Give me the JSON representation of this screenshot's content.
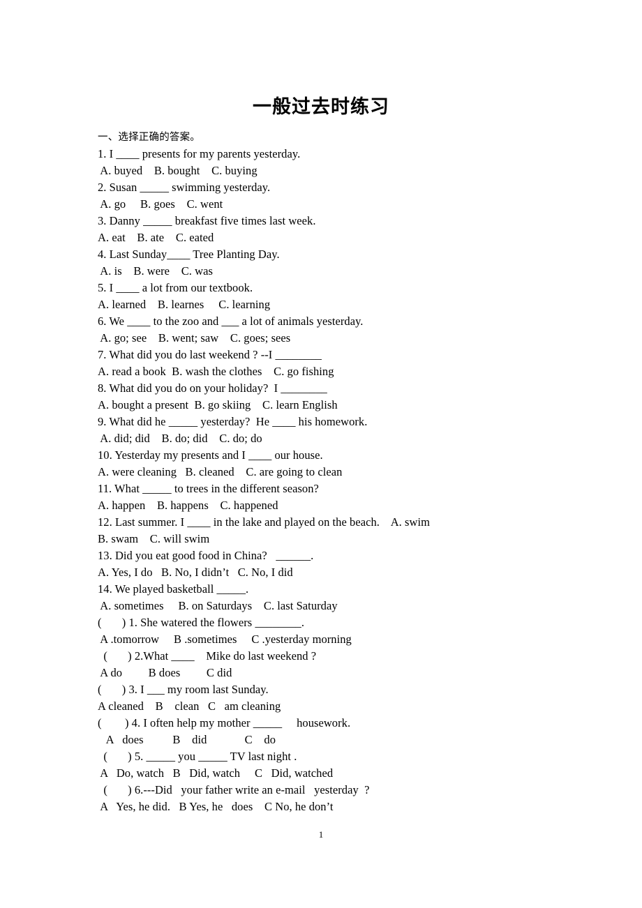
{
  "document": {
    "title": "一般过去时练习",
    "page_number": "1",
    "section_heading": "一、选择正确的答案。"
  },
  "lines": [
    {
      "text": "1. I ____ presents for my parents yesterday.",
      "kind": "question"
    },
    {
      "text": " A. buyed    B. bought    C. buying",
      "kind": "options"
    },
    {
      "text": "2. Susan _____ swimming yesterday.",
      "kind": "question"
    },
    {
      "text": " A. go     B. goes    C. went",
      "kind": "options"
    },
    {
      "text": "3. Danny _____ breakfast five times last week.",
      "kind": "question"
    },
    {
      "text": "A. eat    B. ate    C. eated",
      "kind": "options"
    },
    {
      "text": "4. Last Sunday____ Tree Planting Day.",
      "kind": "question"
    },
    {
      "text": " A. is    B. were    C. was",
      "kind": "options"
    },
    {
      "text": "5. I ____ a lot from our textbook.",
      "kind": "question"
    },
    {
      "text": "A. learned    B. learnes     C. learning",
      "kind": "options"
    },
    {
      "text": "6. We ____ to the zoo and ___ a lot of animals yesterday.",
      "kind": "question"
    },
    {
      "text": " A. go; see    B. went; saw    C. goes; sees",
      "kind": "options"
    },
    {
      "text": "7. What did you do last weekend ? --I ________",
      "kind": "question"
    },
    {
      "text": "A. read a book  B. wash the clothes    C. go fishing",
      "kind": "options"
    },
    {
      "text": "8. What did you do on your holiday?  I ________",
      "kind": "question"
    },
    {
      "text": "A. bought a present  B. go skiing    C. learn English",
      "kind": "options"
    },
    {
      "text": "9. What did he _____ yesterday?  He ____ his homework.",
      "kind": "question"
    },
    {
      "text": " A. did; did    B. do; did    C. do; do",
      "kind": "options"
    },
    {
      "text": "10. Yesterday my presents and I ____ our house.",
      "kind": "question"
    },
    {
      "text": "A. were cleaning   B. cleaned    C. are going to clean",
      "kind": "options"
    },
    {
      "text": "11. What _____ to trees in the different season?",
      "kind": "question"
    },
    {
      "text": "A. happen    B. happens    C. happened",
      "kind": "options"
    },
    {
      "text": "12. Last summer. I ____ in the lake and played on the beach.    A. swim",
      "kind": "question"
    },
    {
      "text": "B. swam    C. will swim",
      "kind": "options"
    },
    {
      "text": "13. Did you eat good food in China?   ______.",
      "kind": "question"
    },
    {
      "text": "A. Yes, I do   B. No, I didn’t   C. No, I did",
      "kind": "options"
    },
    {
      "text": "14. We played basketball _____.",
      "kind": "question"
    },
    {
      "text": " A. sometimes     B. on Saturdays    C. last Saturday",
      "kind": "options"
    },
    {
      "text": "(       ) 1. She watered the flowers ________.",
      "kind": "question"
    },
    {
      "text": " A .tomorrow     B .sometimes     C .yesterday morning",
      "kind": "options"
    },
    {
      "text": "  (       ) 2.What ____    Mike do last weekend ?",
      "kind": "question"
    },
    {
      "text": " A do         B does         C did",
      "kind": "options"
    },
    {
      "text": "(       ) 3. I ___ my room last Sunday.",
      "kind": "question"
    },
    {
      "text": "A cleaned    B    clean   C   am cleaning",
      "kind": "options"
    },
    {
      "text": "(        ) 4. I often help my mother _____     housework.",
      "kind": "question"
    },
    {
      "text": "   A   does          B    did             C    do",
      "kind": "options"
    },
    {
      "text": "  (       ) 5. _____ you _____ TV last night .",
      "kind": "question"
    },
    {
      "text": " A   Do, watch   B   Did, watch     C   Did, watched",
      "kind": "options"
    },
    {
      "text": "  (       ) 6.---Did   your father write an e-mail   yesterday  ?",
      "kind": "question"
    },
    {
      "text": " A   Yes, he did.   B Yes, he   does    C No, he don’t",
      "kind": "options"
    }
  ]
}
